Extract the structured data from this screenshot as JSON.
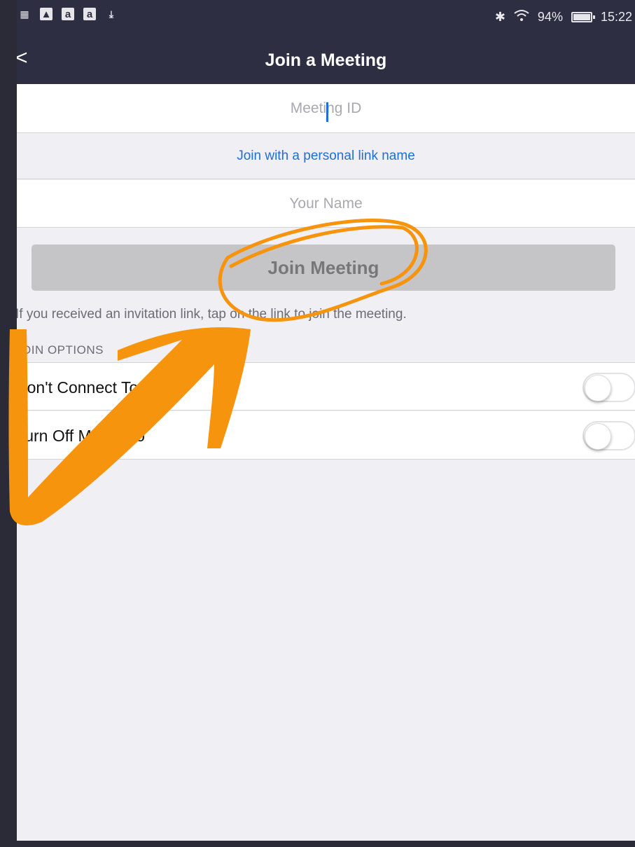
{
  "status_bar": {
    "icons_left": [
      "notification-icon",
      "image-icon",
      "amazon-icon",
      "amazon-icon",
      "download-icon"
    ],
    "amazon_glyph": "a",
    "battery_level": 0.94,
    "battery": "94%",
    "time": "15:22"
  },
  "nav": {
    "back": "<",
    "title": "Join a Meeting"
  },
  "form": {
    "meeting_id_placeholder": "Meeting ID",
    "personal_link": "Join with a personal link name",
    "name_placeholder": "Your Name",
    "join_button": "Join Meeting",
    "hint": "If you received an invitation link, tap on the link to join the meeting."
  },
  "options": {
    "header": "JOIN OPTIONS",
    "items": [
      {
        "label": "Don't Connect To Audio",
        "on": false
      },
      {
        "label": "Turn Off My Video",
        "on": false
      }
    ]
  },
  "colors": {
    "nav_bg": "#2d2e42",
    "link": "#1f6fd6",
    "annotation": "#f7940d",
    "button_disabled": "#c5c5c8"
  }
}
